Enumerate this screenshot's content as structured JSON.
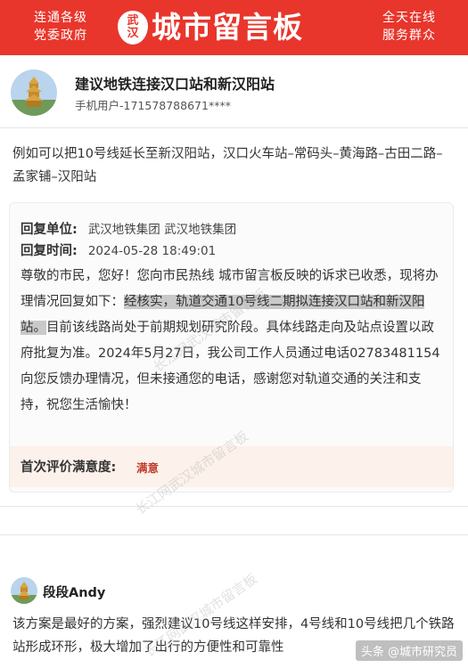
{
  "header": {
    "left_line1": "连通各级",
    "left_line2": "党委政府",
    "badge_char1": "武",
    "badge_char2": "汉",
    "title": "城市留言板",
    "right_line1": "全天在线",
    "right_line2": "服务群众"
  },
  "post": {
    "title": "建议地铁连接汉口站和新汉阳站",
    "user": "手机用户-171578788671****",
    "content": "例如可以把10号线延长至新汉阳站，汉口火车站–常码头–黄海路–古田二路–孟家铺–汉阳站"
  },
  "reply": {
    "unit_label": "回复单位:",
    "unit_value": "武汉地铁集团 武汉地铁集团",
    "time_label": "回复时间:",
    "time_value": "2024-05-28 18:49:01",
    "text_before": "尊敬的市民，您好！您向市民热线 城市留言板反映的诉求已收悉，现将办理情况回复如下：",
    "text_highlight": "经核实，轨道交通10号线二期拟连接汉口站和新汉阳站。",
    "text_after": "目前该线路尚处于前期规划研究阶段。具体线路走向及站点设置以政府批复为准。2024年5月27日，我公司工作人员通过电话02783481154向您反馈办理情况，但未接通您的电话，感谢您对轨道交通的关注和支持，祝您生活愉快！",
    "rating_label": "首次评价满意度:",
    "rating_value": "满意"
  },
  "comment": {
    "name": "段段Andy",
    "text": "该方案是最好的方案，强烈建议10号线这样安排，4号线和10号线把几个铁路站形成环形，极大增加了出行的方便性和可靠性"
  },
  "source_tag": "头条 @城市研究员",
  "watermark_text": "长江网武汉城市留言板",
  "colors": {
    "brand_red": "#e8362c",
    "rating_red": "#c0392b",
    "highlight_gray": "#c9c9c9"
  }
}
